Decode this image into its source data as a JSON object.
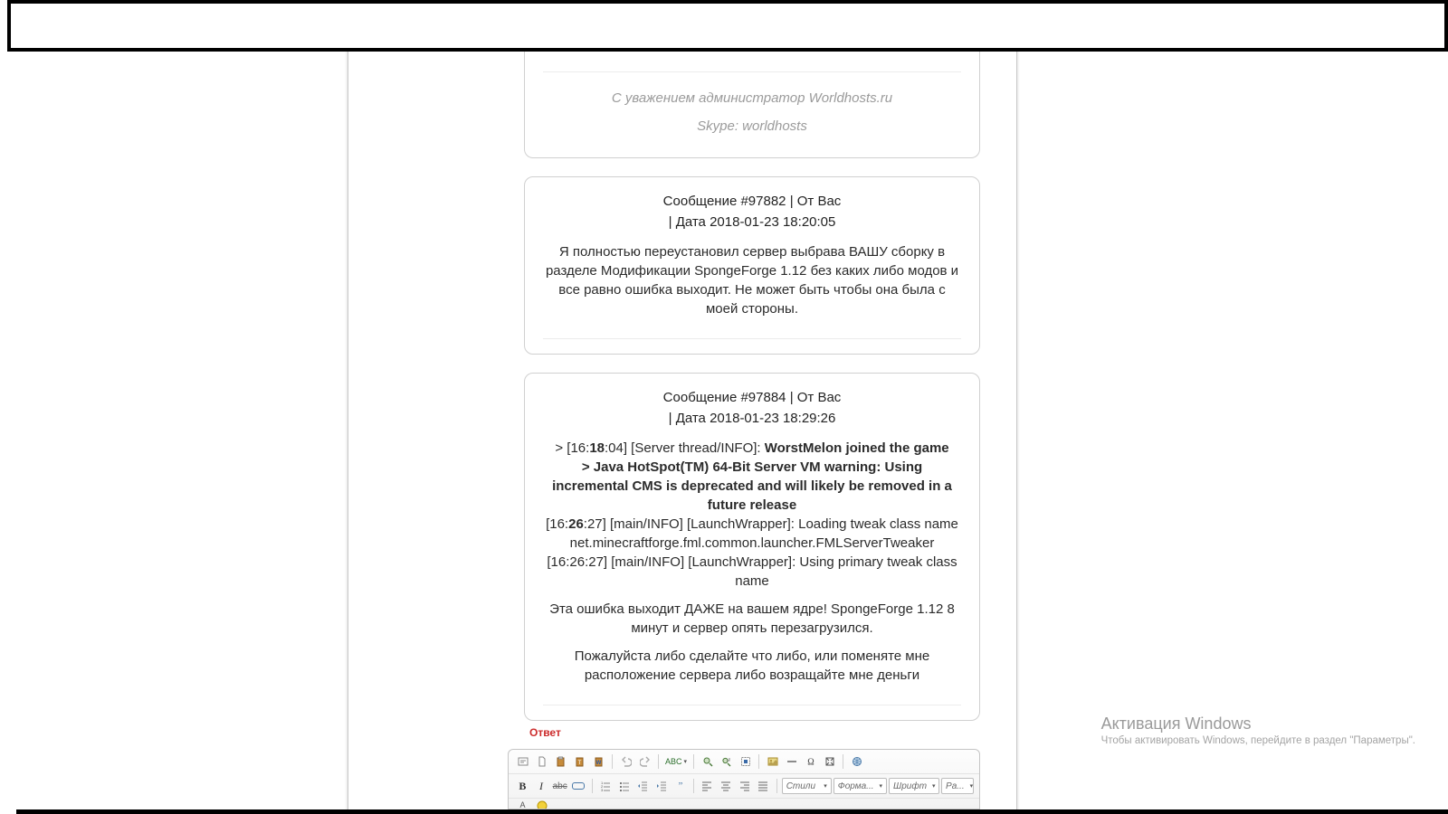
{
  "signature": {
    "line1": "С уважением администратор Worldhosts.ru",
    "line2": "Skype: worldhosts"
  },
  "messages": [
    {
      "header_line1": "Сообщение #97882 | От Вас",
      "header_line2": "| Дата 2018-01-23 18:20:05",
      "body_plain": "Я полностью переустановил сервер выбрава ВАШУ сборку в разделе Модификации SpongeForge 1.12 без каких либо модов и все равно ошибка выходит. Не может быть чтобы она была с моей стороны."
    },
    {
      "header_line1": "Сообщение #97884 | От Вас",
      "header_line2": "| Дата 2018-01-23 18:29:26",
      "log_pre": "> [16:",
      "log_bold_18": "18",
      "log_after_18": ":04] [Server thread/INFO]: ",
      "log_bold_joined": "WorstMelon joined the game",
      "log_bold_java": "> Java HotSpot(TM) 64-Bit Server VM warning: Using incremental CMS is deprecated and will likely be removed in a future release",
      "log_line3_a": "[16:",
      "log_line3_b": "26",
      "log_line3_c": ":27] [main/INFO] [LaunchWrapper]: Loading tweak class name net.minecraftforge.fml.common.launcher.FMLServerTweaker",
      "log_line4": "[16:26:27] [main/INFO] [LaunchWrapper]: Using primary tweak class name",
      "para1": "Эта ошибка выходит ДАЖЕ на вашем ядре! SpongeForge 1.12  8 минут и сервер опять перезагрузился.",
      "para2": "Пожалуйста либо сделайте что либо, или поменяте мне расположение сервера либо возращайте мне деньги"
    }
  ],
  "reply": {
    "label": "Ответ"
  },
  "toolbar": {
    "spell": "ABC",
    "selects": {
      "styles": "Стили",
      "format": "Форма...",
      "font": "Шрифт",
      "size": "Ра..."
    }
  },
  "watermark": {
    "title": "Активация Windows",
    "subtitle": "Чтобы активировать Windows, перейдите в раздел \"Параметры\"."
  }
}
